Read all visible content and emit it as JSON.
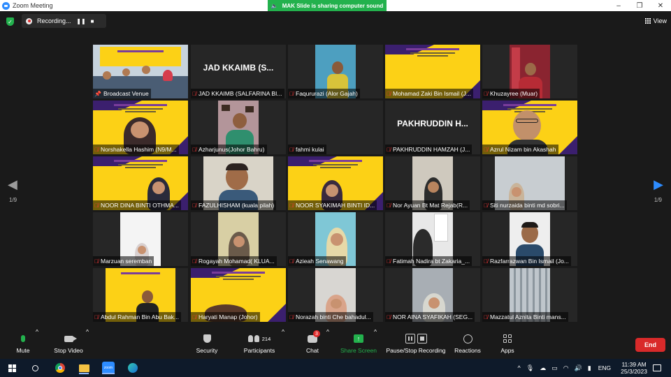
{
  "window": {
    "title": "Zoom Meeting",
    "controls": [
      "–",
      "❐",
      "✕"
    ]
  },
  "share_banner": {
    "text": "MAK Slide is sharing computer sound"
  },
  "recording": {
    "label": "Recording...",
    "pause": "❚❚",
    "stop": "■"
  },
  "view": {
    "label": "View"
  },
  "pagination": {
    "left": "1/9",
    "right": "1/9",
    "prev_arrow": "◀",
    "next_arrow": "▶"
  },
  "participants": [
    {
      "name": "Broadcast Venue",
      "muted": false
    },
    {
      "name": "JAD KKAIMB (SALFARINA BI...",
      "display_name": "JAD KKAIMB (S...",
      "muted": true
    },
    {
      "name": "Faqururazi (Alor Gajah)",
      "muted": true
    },
    {
      "name": "Mohamad Zaki Bin Ismail (J...",
      "muted": true
    },
    {
      "name": "Khuzayree (Muar)",
      "muted": true
    },
    {
      "name": "Norshakella Hashim (N9/M...",
      "muted": true
    },
    {
      "name": "Azharjunus(Johor Bahru)",
      "muted": true
    },
    {
      "name": "fahmi kulai",
      "muted": true
    },
    {
      "name": "PAKHRUDDIN HAMZAH (J...",
      "display_name": "PAKHRUDDIN H...",
      "muted": true
    },
    {
      "name": "Azrul Nizam bin Akashah",
      "muted": true
    },
    {
      "name": "NOOR DINA BINTI OTHMA...",
      "muted": true
    },
    {
      "name": "FAZULHISHAM (kuala pilah)",
      "muted": true
    },
    {
      "name": "NOOR SYAKIMAH BINTI ID...",
      "muted": true
    },
    {
      "name": "Nor Ayuan Bt Mat Rejab(R...",
      "muted": true
    },
    {
      "name": "Siti nurzaida binti md sobri...",
      "muted": true
    },
    {
      "name": "Marzuan seremban",
      "muted": true
    },
    {
      "name": "Rogayah Mohamad( KLUA...",
      "muted": true
    },
    {
      "name": "Azieah Senawang",
      "muted": true
    },
    {
      "name": "Fatimah Nadira bt Zakaria_...",
      "muted": true
    },
    {
      "name": "Razfarrazwan Bin Ismail (Jo...",
      "muted": true
    },
    {
      "name": "Abdul Rahman Bin Abu Bak...",
      "muted": true
    },
    {
      "name": "Haryati Manap (Johor)",
      "muted": true
    },
    {
      "name": "Norazah binti Che bahadul...",
      "muted": true
    },
    {
      "name": "NOR AINA SYAFIKAH (SEG...",
      "muted": true
    },
    {
      "name": "Mazzatul Aznita Binti mans...",
      "muted": true
    }
  ],
  "toolbar": {
    "mute": "Mute",
    "stop_video": "Stop Video",
    "security": "Security",
    "participants": "Participants",
    "participants_count": "214",
    "chat": "Chat",
    "chat_badge": "3",
    "share_screen": "Share Screen",
    "pause_stop_recording": "Pause/Stop Recording",
    "reactions": "Reactions",
    "apps": "Apps",
    "end": "End",
    "caret": "^"
  },
  "taskbar": {
    "zoom_label": "zoom",
    "language": "ENG",
    "time": "11:39 AM",
    "date": "25/3/2023",
    "tray_caret": "^"
  },
  "colors": {
    "zoom_blue": "#2d8cff",
    "share_green": "#23b14d",
    "end_red": "#d92a2a",
    "banner_yellow": "#fcd116",
    "banner_purple": "#3b1f6e",
    "active_speaker": "#c9d72f"
  }
}
